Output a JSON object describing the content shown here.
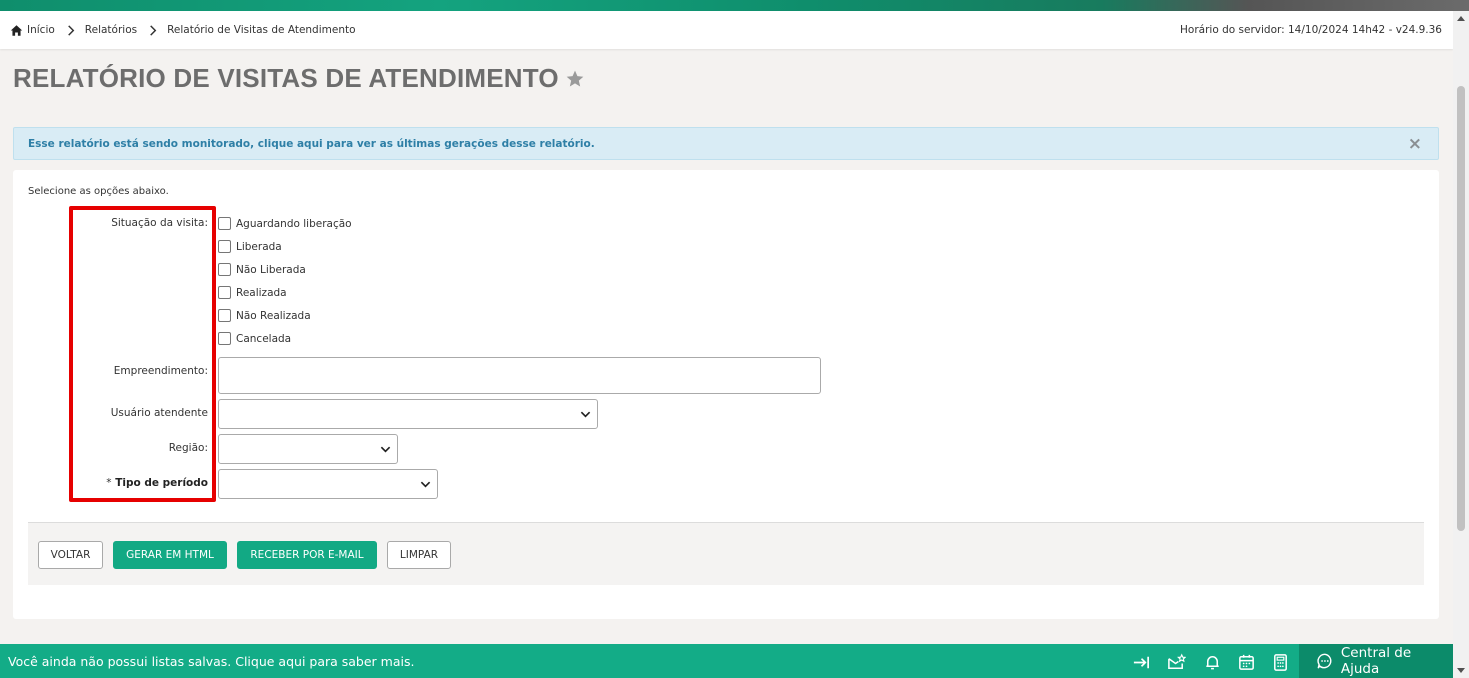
{
  "breadcrumb": {
    "items": [
      "Início",
      "Relatórios",
      "Relatório de Visitas de Atendimento"
    ],
    "server_time": "Horário do servidor: 14/10/2024 14h42 - v24.9.36"
  },
  "page": {
    "title": "RELATÓRIO DE VISITAS DE ATENDIMENTO"
  },
  "alert": {
    "text": "Esse relatório está sendo monitorado, clique aqui para ver as últimas gerações desse relatório.",
    "close": "×"
  },
  "form": {
    "hint": "Selecione as opções abaixo.",
    "situacao_label": "Situação da visita:",
    "situacao_options": [
      "Aguardando liberação",
      "Liberada",
      "Não Liberada",
      "Realizada",
      "Não Realizada",
      "Cancelada"
    ],
    "empreendimento_label": "Empreendimento:",
    "usuario_label": "Usuário atendente",
    "regiao_label": "Região:",
    "tipo_periodo_star": "*",
    "tipo_periodo_label": "Tipo de período"
  },
  "buttons": {
    "voltar": "VOLTAR",
    "gerar_html": "GERAR EM HTML",
    "receber_email": "RECEBER POR E-MAIL",
    "limpar": "LIMPAR"
  },
  "footer": {
    "message": "Você ainda não possui listas salvas. Clique aqui para saber mais.",
    "help": "Central de Ajuda"
  },
  "colors": {
    "brand_green": "#13ac87",
    "dark_green": "#0c8b6a",
    "highlight_red": "#e60000",
    "alert_text": "#2e7fa6"
  }
}
